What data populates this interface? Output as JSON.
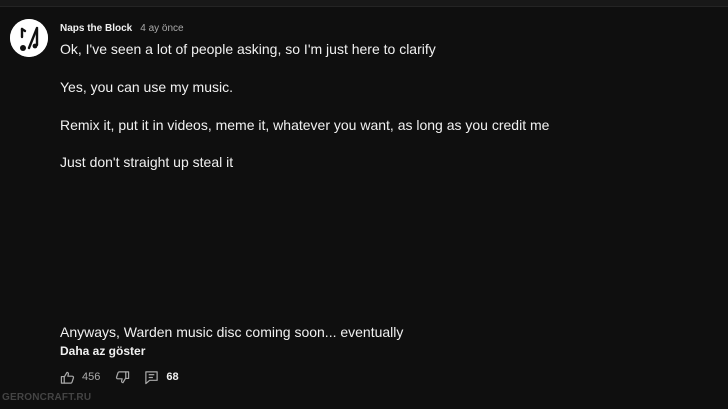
{
  "comment": {
    "author": "Naps the Block",
    "timestamp": "4 ay önce",
    "lines": [
      "Ok, I've seen a lot of people asking, so I'm just here to clarify",
      "Yes, you can use my music.",
      "Remix it, put it in videos, meme it, whatever you want, as long as you credit me",
      "Just don't straight up steal it",
      "Anyways, Warden music disc coming soon... eventually"
    ],
    "show_less_label": "Daha az göster",
    "like_count": "456",
    "reply_count": "68"
  },
  "icons": {
    "avatar": "music-note-avatar-icon",
    "like": "thumbs-up-icon",
    "dislike": "thumbs-down-icon",
    "replies": "comment-bubble-icon"
  },
  "colors": {
    "background": "#0f0f0f",
    "text": "#f1f1f1",
    "secondary_text": "#aaaaaa",
    "watermark": "#444444"
  },
  "watermark": "GERONCRAFT.RU"
}
